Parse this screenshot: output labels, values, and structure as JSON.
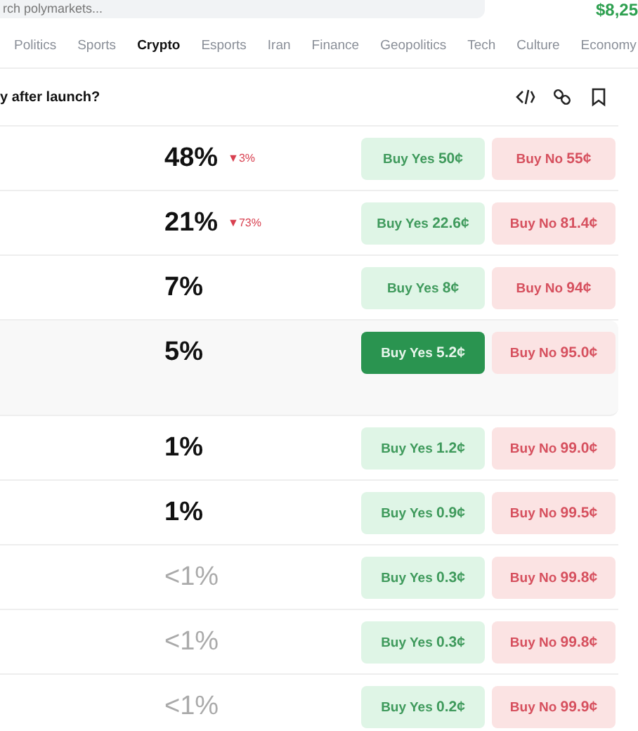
{
  "search": {
    "placeholder": "rch polymarkets..."
  },
  "balance": "$8,25",
  "nav": [
    {
      "label": "Politics",
      "selected": false
    },
    {
      "label": "Sports",
      "selected": false
    },
    {
      "label": "Crypto",
      "selected": true
    },
    {
      "label": "Esports",
      "selected": false
    },
    {
      "label": "Iran",
      "selected": false
    },
    {
      "label": "Finance",
      "selected": false
    },
    {
      "label": "Geopolitics",
      "selected": false
    },
    {
      "label": "Tech",
      "selected": false
    },
    {
      "label": "Culture",
      "selected": false
    },
    {
      "label": "Economy",
      "selected": false
    }
  ],
  "market": {
    "title": "y after launch?"
  },
  "outcomes": [
    {
      "chance": "48%",
      "change": "▼3%",
      "muted": false,
      "hovered": false,
      "yes": {
        "label": "Buy Yes",
        "price": "50¢"
      },
      "no": {
        "label": "Buy No",
        "price": "55¢"
      }
    },
    {
      "chance": "21%",
      "change": "▼73%",
      "muted": false,
      "hovered": false,
      "yes": {
        "label": "Buy Yes",
        "price": "22.6¢"
      },
      "no": {
        "label": "Buy No",
        "price": "81.4¢"
      }
    },
    {
      "chance": "7%",
      "muted": false,
      "hovered": false,
      "yes": {
        "label": "Buy Yes",
        "price": "8¢"
      },
      "no": {
        "label": "Buy No",
        "price": "94¢"
      }
    },
    {
      "chance": "5%",
      "muted": false,
      "hovered": true,
      "yes": {
        "label": "Buy Yes",
        "price": "5.2¢"
      },
      "no": {
        "label": "Buy No",
        "price": "95.0¢"
      }
    },
    {
      "chance": "1%",
      "muted": false,
      "hovered": false,
      "yes": {
        "label": "Buy Yes",
        "price": "1.2¢"
      },
      "no": {
        "label": "Buy No",
        "price": "99.0¢"
      }
    },
    {
      "chance": "1%",
      "muted": false,
      "hovered": false,
      "yes": {
        "label": "Buy Yes",
        "price": "0.9¢"
      },
      "no": {
        "label": "Buy No",
        "price": "99.5¢"
      }
    },
    {
      "chance": "<1%",
      "muted": true,
      "hovered": false,
      "yes": {
        "label": "Buy Yes",
        "price": "0.3¢"
      },
      "no": {
        "label": "Buy No",
        "price": "99.8¢"
      }
    },
    {
      "chance": "<1%",
      "muted": true,
      "hovered": false,
      "yes": {
        "label": "Buy Yes",
        "price": "0.3¢"
      },
      "no": {
        "label": "Buy No",
        "price": "99.8¢"
      }
    },
    {
      "chance": "<1%",
      "muted": true,
      "hovered": false,
      "yes": {
        "label": "Buy Yes",
        "price": "0.2¢"
      },
      "no": {
        "label": "Buy No",
        "price": "99.9¢"
      }
    }
  ]
}
